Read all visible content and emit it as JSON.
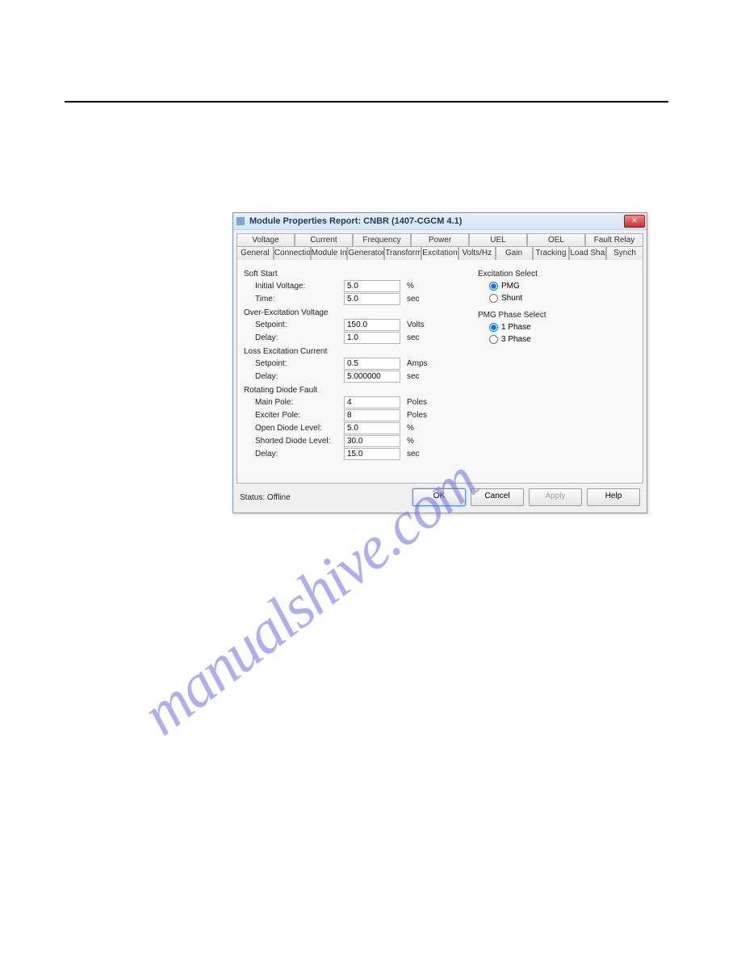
{
  "watermark": "manualshive.com",
  "dialog": {
    "title": "Module Properties Report: CNBR (1407-CGCM 4.1)",
    "tabs_row1": [
      "Voltage",
      "Current",
      "Frequency",
      "Power",
      "UEL",
      "OEL",
      "Fault Relay"
    ],
    "tabs_row2": [
      "General",
      "Connection",
      "Module Info",
      "Generator",
      "Transformers",
      "Excitation",
      "Volts/Hz",
      "Gain",
      "Tracking",
      "Load Share",
      "Synch"
    ],
    "active_tab": "Excitation",
    "soft_start": {
      "heading": "Soft Start",
      "initial_voltage_label": "Initial Voltage:",
      "initial_voltage_value": "5.0",
      "initial_voltage_unit": "%",
      "time_label": "Time:",
      "time_value": "5.0",
      "time_unit": "sec"
    },
    "over_excitation": {
      "heading": "Over-Excitation Voltage",
      "setpoint_label": "Setpoint:",
      "setpoint_value": "150.0",
      "setpoint_unit": "Volts",
      "delay_label": "Delay:",
      "delay_value": "1.0",
      "delay_unit": "sec"
    },
    "loss_excitation": {
      "heading": "Loss Excitation Current",
      "setpoint_label": "Setpoint:",
      "setpoint_value": "0.5",
      "setpoint_unit": "Amps",
      "delay_label": "Delay:",
      "delay_value": "5.000000",
      "delay_unit": "sec"
    },
    "rotating_diode": {
      "heading": "Rotating Diode Fault",
      "main_pole_label": "Main Pole:",
      "main_pole_value": "4",
      "main_pole_unit": "Poles",
      "exciter_pole_label": "Exciter Pole:",
      "exciter_pole_value": "8",
      "exciter_pole_unit": "Poles",
      "open_diode_label": "Open Diode Level:",
      "open_diode_value": "5.0",
      "open_diode_unit": "%",
      "shorted_diode_label": "Shorted Diode Level:",
      "shorted_diode_value": "30.0",
      "shorted_diode_unit": "%",
      "delay_label": "Delay:",
      "delay_value": "15.0",
      "delay_unit": "sec"
    },
    "excitation_select": {
      "heading": "Excitation Select",
      "pmg": "PMG",
      "shunt": "Shunt"
    },
    "pmg_phase": {
      "heading": "PMG Phase Select",
      "one_phase": "1 Phase",
      "three_phase": "3 Phase"
    },
    "status_label": "Status:",
    "status_value": "Offline",
    "buttons": {
      "ok": "OK",
      "cancel": "Cancel",
      "apply": "Apply",
      "help": "Help"
    }
  }
}
